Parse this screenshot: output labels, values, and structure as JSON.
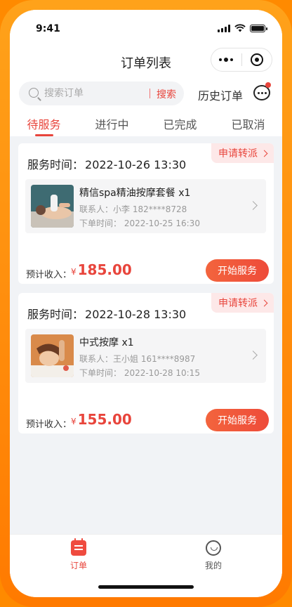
{
  "status_bar": {
    "time": "9:41"
  },
  "nav": {
    "title": "订单列表"
  },
  "search": {
    "placeholder": "搜索订单",
    "button_label": "搜索",
    "history_label": "历史订单"
  },
  "tabs": [
    {
      "label": "待服务",
      "active": true
    },
    {
      "label": "进行中",
      "active": false
    },
    {
      "label": "已完成",
      "active": false
    },
    {
      "label": "已取消",
      "active": false
    }
  ],
  "orders": [
    {
      "reassign_label": "申请转派",
      "service_time_label": "服务时间：",
      "service_time": "2022-10-26 13:30",
      "item_name": "精信spa精油按摩套餐  x1",
      "contact": "联系人：小李   182****8728",
      "order_time": "下单时间：  2022-10-25 16:30",
      "income_label": "预计收入：",
      "currency": "¥",
      "income": "185.00",
      "action_label": "开始服务"
    },
    {
      "reassign_label": "申请转派",
      "service_time_label": "服务时间：",
      "service_time": "2022-10-28 13:30",
      "item_name": "中式按摩  x1",
      "contact": "联系人：王小姐   161****8987",
      "order_time": "下单时间：  2022-10-28 10:15",
      "income_label": "预计收入：",
      "currency": "¥",
      "income": "155.00",
      "action_label": "开始服务"
    }
  ],
  "tabbar": [
    {
      "label": "订单",
      "icon": "order-list-icon",
      "active": true
    },
    {
      "label": "我的",
      "icon": "smile-face-icon",
      "active": false
    }
  ],
  "colors": {
    "accent": "#e8453c",
    "frame": "#ff8a00",
    "background": "#f1f3f6"
  }
}
